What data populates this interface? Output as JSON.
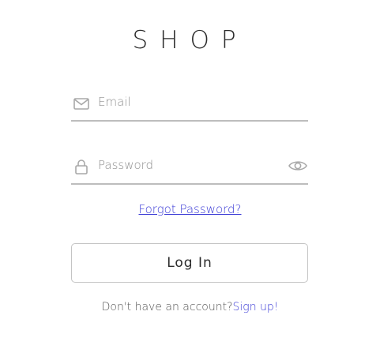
{
  "brand": {
    "logo_text": "SHOP"
  },
  "form": {
    "email": {
      "placeholder": "Email",
      "value": "",
      "icon": "envelope-icon"
    },
    "password": {
      "placeholder": "Password",
      "value": "",
      "icon": "lock-icon",
      "toggle_icon": "eye-icon"
    },
    "forgot_label": "Forgot Password?",
    "login_label": "Log In"
  },
  "signup": {
    "prompt": "Don't have an account?",
    "link_label": "Sign up!"
  },
  "colors": {
    "link": "#3b3bd6",
    "underline": "#bdbdbd",
    "icon": "#a8a8a8",
    "text": "#2b2b2b"
  }
}
